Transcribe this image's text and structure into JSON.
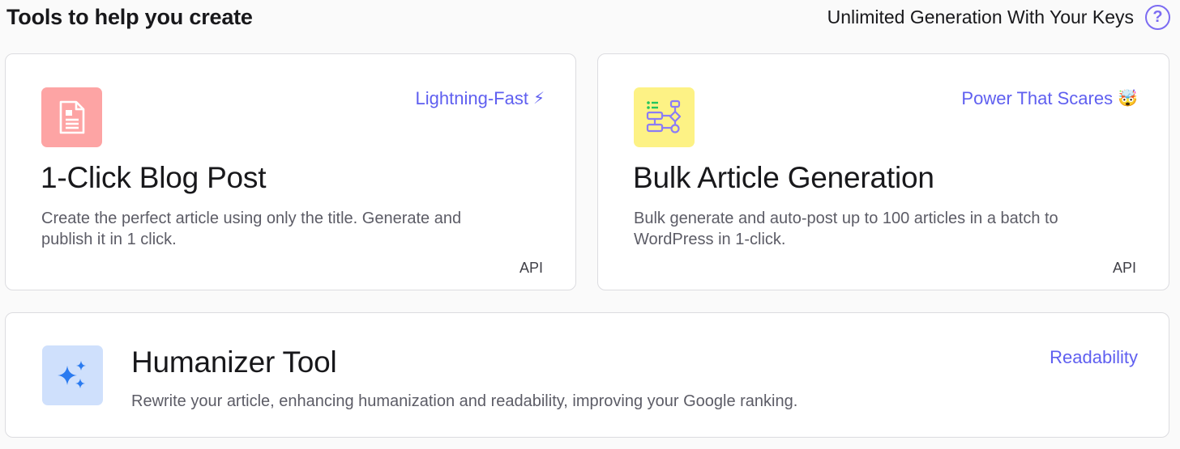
{
  "header": {
    "title": "Tools to help you create",
    "link_label": "Unlimited Generation With Your Keys",
    "help_glyph": "?"
  },
  "cards": [
    {
      "icon": "document-icon",
      "badge": "Lightning-Fast",
      "badge_emoji": "⚡",
      "title": "1-Click Blog Post",
      "description": "Create the perfect article using only the title. Generate and publish it in 1 click.",
      "api_label": "API"
    },
    {
      "icon": "flowchart-icon",
      "badge": "Power That Scares",
      "badge_emoji": "🤯",
      "title": "Bulk Article Generation",
      "description": "Bulk generate and auto-post up to 100 articles in a batch to WordPress in 1-click.",
      "api_label": "API"
    },
    {
      "icon": "sparkles-icon",
      "badge": "Readability",
      "title": "Humanizer Tool",
      "description": "Rewrite your article, enhancing humanization and readability, improving your Google ranking."
    }
  ],
  "colors": {
    "accent": "#5f5ff0",
    "help_icon": "#7c6cf2",
    "tile_red": "#fda4a4",
    "tile_yellow": "#fdf285",
    "tile_blue": "#cfe0fc"
  }
}
